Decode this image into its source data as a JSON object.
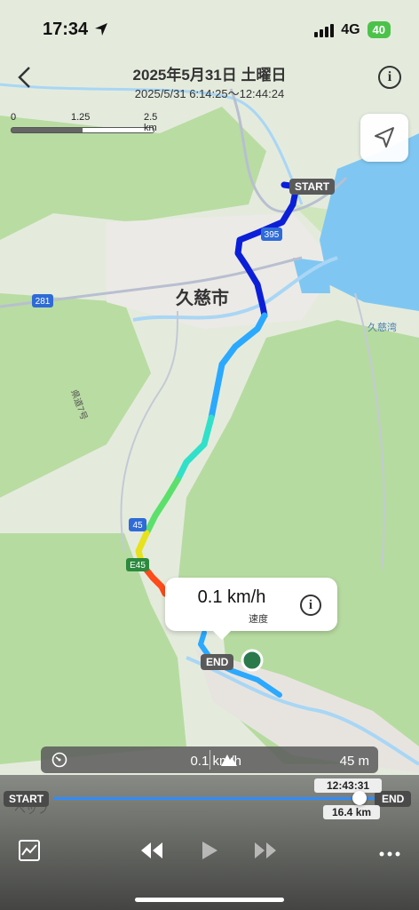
{
  "status_bar": {
    "time": "17:34",
    "network": "4G",
    "battery": "40"
  },
  "header": {
    "title": "2025年5月31日 土曜日",
    "subtitle": "2025/5/31 6:14:25〜12:44:24"
  },
  "map": {
    "scale": {
      "label_0": "0",
      "label_1": "1.25",
      "label_2": "2.5 km"
    },
    "labels": {
      "city": "久慈市",
      "bay": "久慈湾",
      "route_281": "281",
      "route_395": "395",
      "route_45": "45",
      "route_e45": "E45",
      "road_name": "県道7号"
    },
    "start_tag": "START",
    "end_tag": "END",
    "route_colors": [
      "#0b1fd8",
      "#2aa9ff",
      "#31e0c9",
      "#5be06b",
      "#e6e21c",
      "#ff4a1a",
      "#e01414"
    ]
  },
  "callout": {
    "value": "0.1 km/h",
    "label": "速度"
  },
  "stats": {
    "speed": "0.1 km/h",
    "altitude": "45 m",
    "speed_icon": "speedometer-icon",
    "altitude_icon": "mountain-icon"
  },
  "timeline": {
    "start": "START",
    "end": "END",
    "current_time": "12:43:31",
    "distance": "16.4 km",
    "position": 0.98,
    "behind_text": "ペップ"
  },
  "controls": {
    "chart_icon": "chart-icon",
    "rewind_icon": "rewind-icon",
    "play_icon": "play-icon",
    "forward_icon": "fast-forward-icon",
    "more_icon": "more-icon"
  }
}
